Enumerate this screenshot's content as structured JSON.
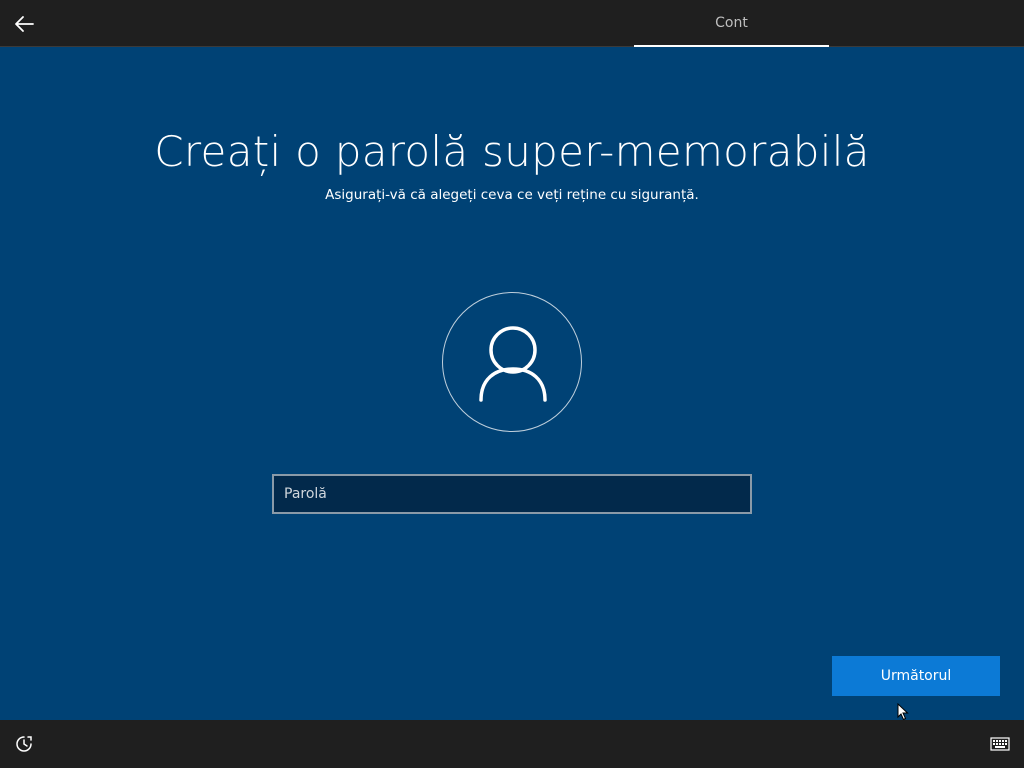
{
  "header": {
    "back_icon": "arrow-left-icon",
    "tab_label": "Cont"
  },
  "main": {
    "title": "Creați o parolă super-memorabilă",
    "subtitle": "Asigurați-vă că alegeți ceva ce veți reține cu siguranță.",
    "avatar_icon": "user-icon",
    "password": {
      "placeholder": "Parolă",
      "value": ""
    },
    "next_label": "Următorul"
  },
  "footer": {
    "ease_of_access_icon": "ease-of-access-icon",
    "keyboard_icon": "keyboard-icon"
  },
  "colors": {
    "background": "#004275",
    "bar": "#1f1f1f",
    "accent": "#0c7ad6"
  }
}
